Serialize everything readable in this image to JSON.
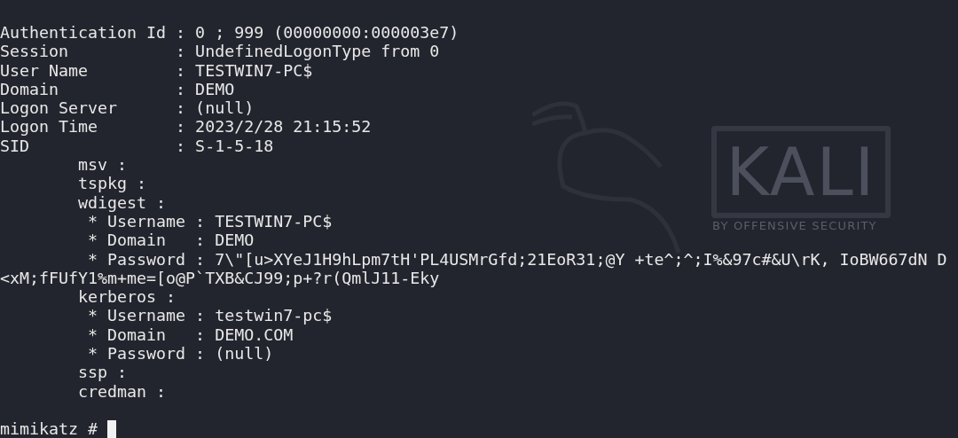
{
  "wallpaper": {
    "logo_word": "KALI",
    "logo_tagline": "BY OFFENSIVE SECURITY"
  },
  "terminal": {
    "lines": [
      {
        "text": "Authentication Id : 0 ; 999 (00000000:000003e7)"
      },
      {
        "text": "Session           : UndefinedLogonType from 0"
      },
      {
        "text": "User Name         : TESTWIN7-PC$"
      },
      {
        "text": "Domain            : DEMO"
      },
      {
        "text": "Logon Server      : (null)"
      },
      {
        "text": "Logon Time        : 2023/2/28 21:15:52"
      },
      {
        "text": "SID               : S-1-5-18"
      },
      {
        "text": "        msv :"
      },
      {
        "text": "        tspkg :"
      },
      {
        "text": "        wdigest :"
      },
      {
        "text": "         * Username : TESTWIN7-PC$"
      },
      {
        "text": "         * Domain   : DEMO"
      },
      {
        "text": "         * Password : 7\\\"[u>XYeJ1H9hLpm7tH'PL4USMrGfd;21EoR31;@Y +te^;^;I%&97c#&U\\rK, IoBW667dN D"
      },
      {
        "text": "<xM;fFUfY1%m+me=[o@P`TXB&CJ99;p+?r(QmlJ11-Eky"
      },
      {
        "text": "        kerberos :"
      },
      {
        "text": "         * Username : testwin7-pc$"
      },
      {
        "text": "         * Domain   : DEMO.COM"
      },
      {
        "text": "         * Password : (null)"
      },
      {
        "text": "        ssp :"
      },
      {
        "text": "        credman :"
      }
    ],
    "prompt": "mimikatz #",
    "cursor": true
  }
}
